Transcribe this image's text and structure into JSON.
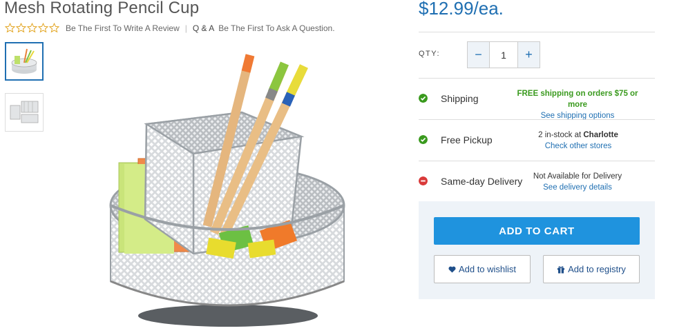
{
  "product": {
    "title": "Mesh Rotating Pencil Cup",
    "rating_stars": 0,
    "rating_max": 5,
    "review_link": "Be The First To Write A Review",
    "qa_label": "Q & A",
    "qa_link": "Be The First To Ask A Question.",
    "price": "$12.99/ea."
  },
  "thumbnails": [
    {
      "name": "thumbnail-pencil-cup",
      "active": true
    },
    {
      "name": "thumbnail-mesh-organizers",
      "active": false
    }
  ],
  "quantity": {
    "label": "QTY:",
    "value": "1",
    "decrement": "−",
    "increment": "+"
  },
  "fulfillment": {
    "shipping": {
      "label": "Shipping",
      "status_icon": "check-circle-icon",
      "status_color": "#3a9a1e",
      "detail": "FREE shipping on orders $75 or more",
      "link": "See shipping options"
    },
    "pickup": {
      "label": "Free Pickup",
      "status_icon": "check-circle-icon",
      "status_color": "#3a9a1e",
      "detail_prefix": "2 in-stock at",
      "store": "Charlotte",
      "link": "Check other stores"
    },
    "delivery": {
      "label": "Same-day Delivery",
      "status_icon": "minus-circle-icon",
      "status_color": "#d93a3a",
      "detail": "Not Available for Delivery",
      "link": "See delivery details"
    }
  },
  "actions": {
    "add_to_cart": "ADD TO CART",
    "wishlist": "Add to wishlist",
    "wishlist_icon": "heart-icon",
    "registry": "Add to registry",
    "registry_icon": "gift-icon"
  },
  "colors": {
    "accent": "#1f6fb2",
    "cart_button": "#1f93de",
    "panel_bg": "#eef3f8"
  }
}
